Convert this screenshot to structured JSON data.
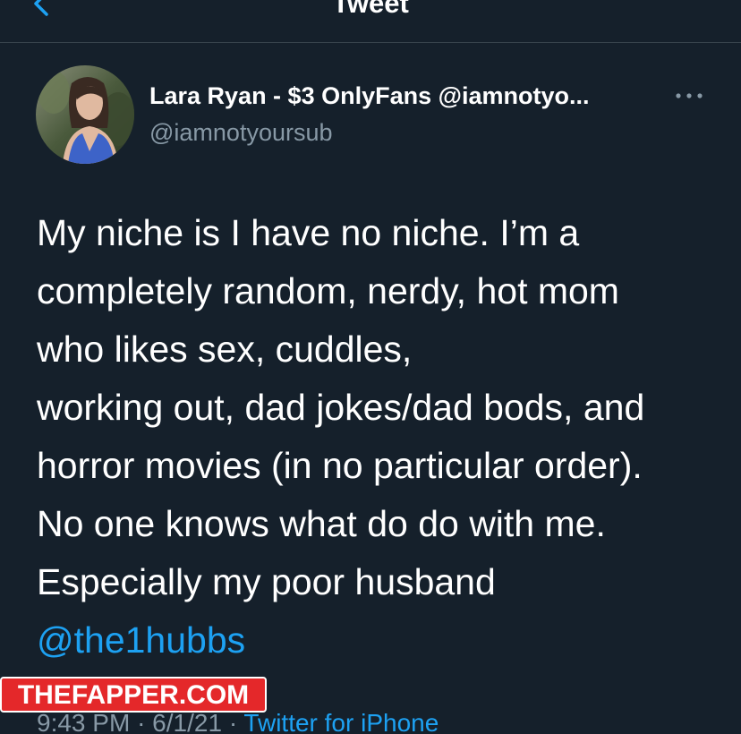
{
  "header": {
    "title": "Tweet",
    "back_icon": "chevron-left-icon"
  },
  "tweet": {
    "author": {
      "display_name": "Lara Ryan - $3 OnlyFans @iamnotyo...",
      "handle": "@iamnotyoursub"
    },
    "more_icon": "more-icon",
    "text_lines": [
      "My niche is I have no niche. I’m a",
      "completely random, nerdy, hot mom",
      "who likes sex, cuddles,",
      "working out, dad jokes/dad bods, and",
      "horror movies (in no particular order).",
      "No one knows what do do with me.",
      "Especially my poor husband"
    ],
    "mention": "@the1hubbs",
    "time": "9:43 PM",
    "separator": "·",
    "date": "6/1/21",
    "source": "Twitter for iPhone"
  },
  "watermark": {
    "text": "THEFAPPER.COM"
  },
  "colors": {
    "background": "#15202b",
    "accent": "#1da1f2",
    "secondary_text": "#8899a6",
    "watermark_red": "#e4282a"
  }
}
